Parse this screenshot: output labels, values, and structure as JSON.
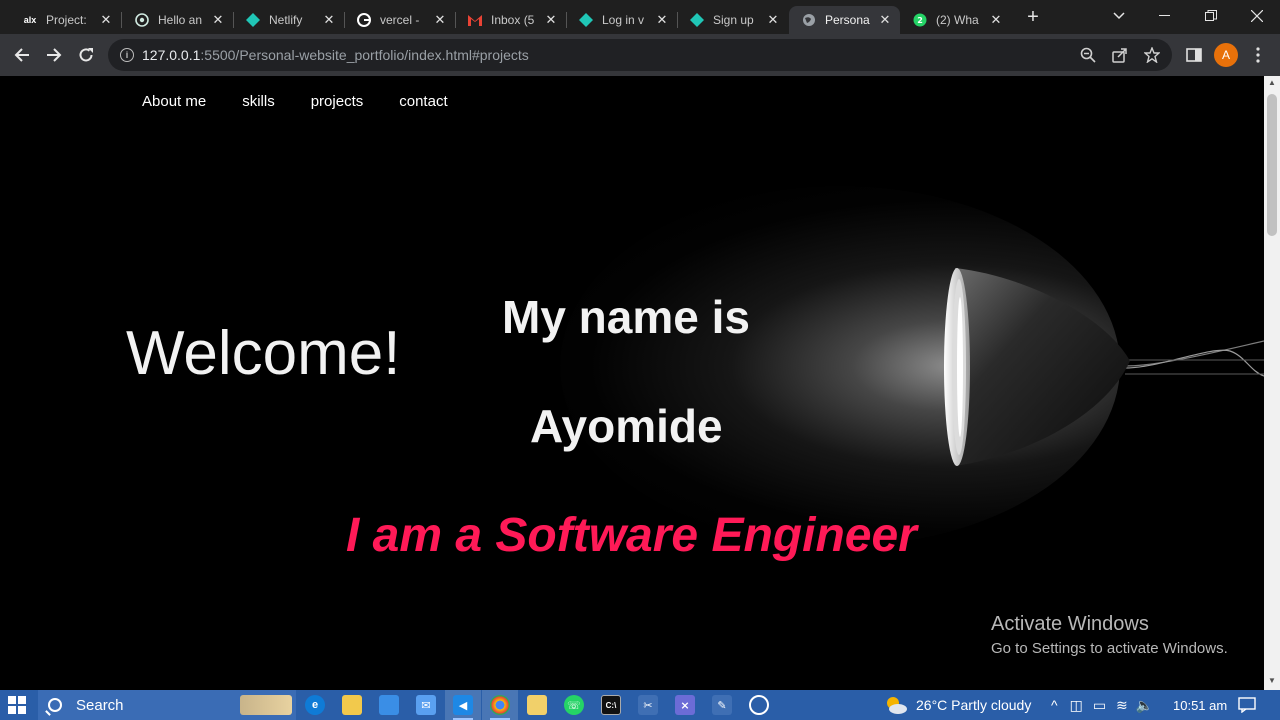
{
  "browser": {
    "tabs": [
      {
        "title": "Project:",
        "icon": "alx-icon",
        "active": false
      },
      {
        "title": "Hello an",
        "icon": "openai-icon",
        "active": false
      },
      {
        "title": "Netlify",
        "icon": "netlify-icon",
        "active": false
      },
      {
        "title": "vercel -",
        "icon": "google-icon",
        "active": false
      },
      {
        "title": "Inbox (5",
        "icon": "gmail-icon",
        "active": false
      },
      {
        "title": "Log in v",
        "icon": "netlify-icon",
        "active": false
      },
      {
        "title": "Sign up",
        "icon": "netlify-icon",
        "active": false
      },
      {
        "title": "Persona",
        "icon": "globe-icon",
        "active": true
      },
      {
        "title": "(2) Wha",
        "icon": "whatsapp-icon",
        "active": false
      }
    ],
    "url_host": "127.0.0.1",
    "url_rest": ":5500/Personal-website_portfolio/index.html#projects",
    "profile_initial": "A"
  },
  "page": {
    "nav": [
      "About me",
      "skills",
      "projects",
      "contact"
    ],
    "welcome": "Welcome!",
    "intro": "My name is",
    "name": "Ayomide",
    "role": "I am a Software Engineer",
    "role_color": "#ff1a57"
  },
  "watermark": {
    "title": "Activate Windows",
    "subtitle": "Go to Settings to activate Windows."
  },
  "taskbar": {
    "search_placeholder": "Search",
    "weather": "26°C  Partly cloudy",
    "time": "10:51 am"
  }
}
